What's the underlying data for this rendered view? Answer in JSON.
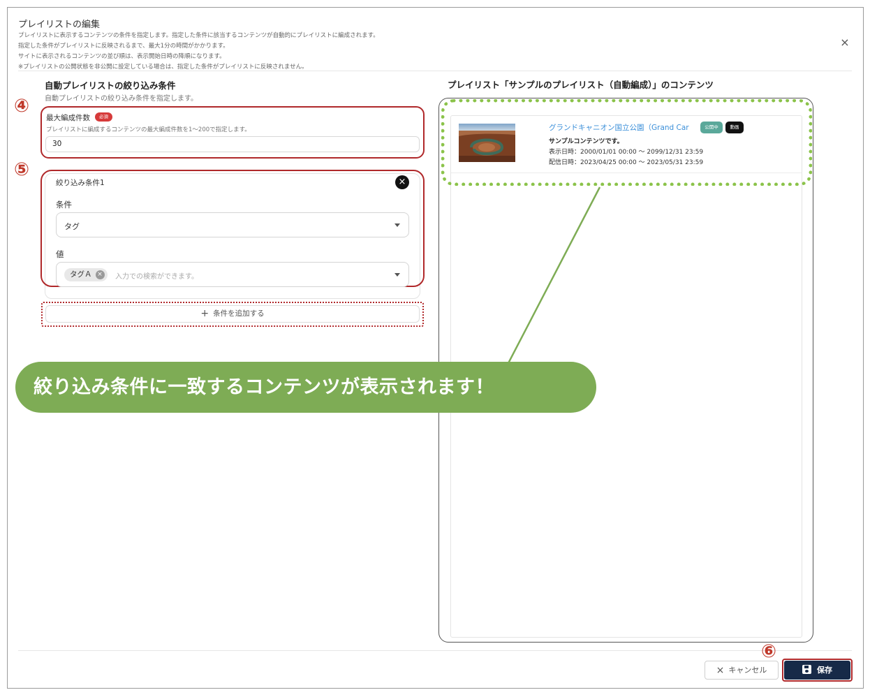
{
  "dialog": {
    "title": "プレイリストの編集",
    "descriptions": [
      "プレイリストに表示するコンテンツの条件を指定します。指定した条件に該当するコンテンツが自動的にプレイリストに編成されます。",
      "指定した条件がプレイリストに反映されるまで、最大1分の時間がかかります。",
      "サイトに表示されるコンテンツの並び順は、表示開始日時の降順になります。",
      "※プレイリストの公開状態を非公開に設定している場合は、指定した条件がプレイリストに反映されません。"
    ],
    "close_icon": "×"
  },
  "filter_section": {
    "title": "自動プレイリストの絞り込み条件",
    "subtitle": "自動プレイリストの絞り込み条件を指定します。",
    "max_count": {
      "label": "最大編成件数",
      "required_badge": "必須",
      "help": "プレイリストに編成するコンテンツの最大編成件数を1〜200で指定します。",
      "value": "30"
    },
    "condition": {
      "title": "絞り込み条件1",
      "remove_icon": "×",
      "condition_label": "条件",
      "condition_value": "タグ",
      "value_label": "値",
      "chip_label": "タグＡ",
      "chip_remove_icon": "×",
      "value_placeholder": "入力での検索ができます。"
    },
    "add_button": {
      "icon": "+",
      "label": "条件を追加する"
    }
  },
  "annotations": {
    "step4": "④",
    "step5": "⑤",
    "step6": "⑥",
    "banner": "絞り込み条件に一致するコンテンツが表示されます！"
  },
  "right_section": {
    "title": "プレイリスト「サンプルのプレイリスト（自動編成）」のコンテンツ",
    "item": {
      "title": "グランドキャニオン国立公園（Grand Car",
      "status_badge": "公開中",
      "type_badge": "動画",
      "description": "サンプルコンテンツです。",
      "display_date": "表示日時：2000/01/01 00:00 〜 2099/12/31 23:59",
      "delivery_date": "配信日時：2023/04/25 00:00 〜 2023/05/31 23:59"
    }
  },
  "footer": {
    "cancel_icon": "×",
    "cancel_label": "キャンセル",
    "save_label": "保存"
  },
  "colors": {
    "highlight_red": "#b0282a",
    "highlight_green": "#8bc34a",
    "banner_green": "#7eac55",
    "save_navy": "#172a48",
    "link_blue": "#3b8fd9",
    "status_teal": "#5aa89a"
  }
}
